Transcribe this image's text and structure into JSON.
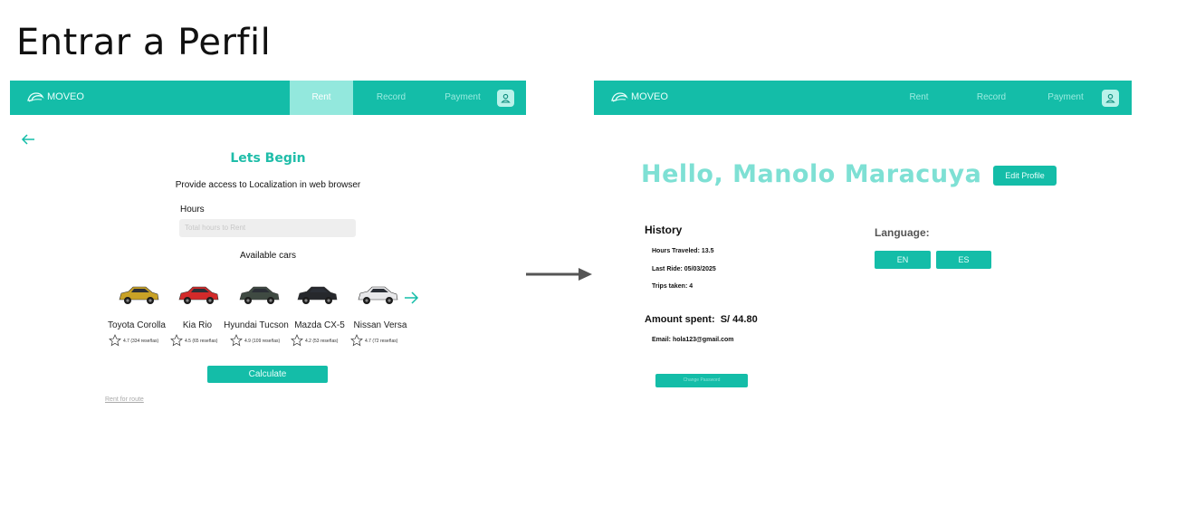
{
  "canvas_title": "Entrar a Perfil",
  "brand": "MOVEO",
  "nav": {
    "rent": "Rent",
    "record": "Record",
    "payment": "Payment"
  },
  "left": {
    "title": "Lets Begin",
    "access_text": "Provide access to  Localization in  web browser",
    "hours_label": "Hours",
    "hours_placeholder": "Total hours to Rent",
    "available_label": "Available cars",
    "cars": [
      {
        "name": "Toyota Corolla",
        "rating": "4.7 (334 reseñas)",
        "color": "#c9a226"
      },
      {
        "name": "Kia Rio",
        "rating": "4.5 (65 reseñas)",
        "color": "#d32a2a"
      },
      {
        "name": "Hyundai Tucson",
        "rating": "4.9 (109 reseñas)",
        "color": "#3f4a42"
      },
      {
        "name": "Mazda CX-5",
        "rating": "4.2 (53 reseñas)",
        "color": "#26282c"
      },
      {
        "name": "Nissan Versa",
        "rating": "4.7 (72 reseñas)",
        "color": "#e8e8ea"
      }
    ],
    "calculate_label": "Calculate",
    "rent_route_link": "Rent for route"
  },
  "right": {
    "greeting": "Hello, Manolo Maracuya",
    "edit_profile": "Edit Profile",
    "history_title": "History",
    "hours_traveled": "Hours Traveled: 13.5",
    "last_ride": "Last Ride: 05/03/2025",
    "trips_taken": "Trips taken: 4",
    "amount_spent": "Amount spent:  S/ 44.80",
    "email": "Email: hola123@gmail.com",
    "change_password": "Change Password",
    "language_label": "Language:",
    "lang_en": "EN",
    "lang_es": "ES"
  },
  "colors": {
    "primary": "#14bda8",
    "active_tab": "#93e8dd",
    "title_teal": "#1fbda9",
    "greeting_teal": "#7ee0d4",
    "connector": "#555555"
  }
}
